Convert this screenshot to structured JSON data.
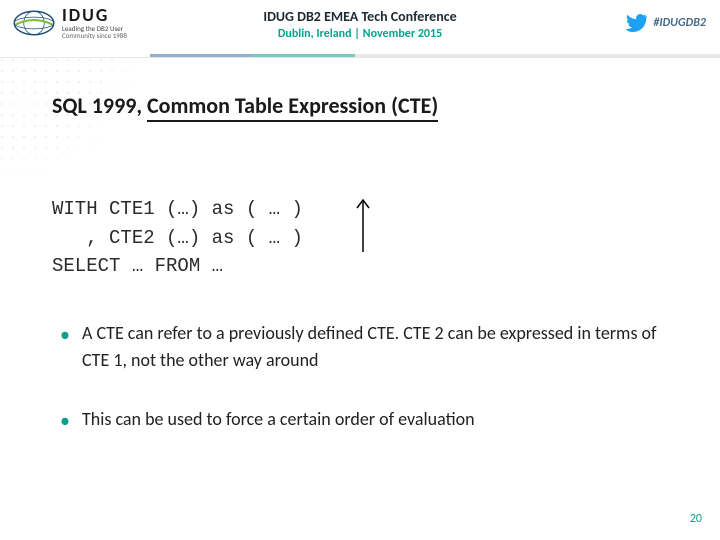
{
  "header": {
    "brand": "IDUG",
    "tagline1": "Leading the DB2 User",
    "tagline2": "Community since 1988",
    "conference_title": "IDUG DB2 EMEA Tech Conference",
    "conference_location": "Dublin, Ireland  |  November 2015",
    "hashtag": "#IDUGDB2"
  },
  "title_prefix": "SQL 1999, ",
  "title_rest": "Common Table Expression (CTE)",
  "code": {
    "l1": "WITH CTE1 (…) as ( … )",
    "l2": "   , CTE2 (…) as ( … )",
    "l3": "SELECT … FROM …"
  },
  "bullets": {
    "b1": "A CTE can refer to a previously defined CTE. CTE 2 can be expressed in terms of CTE 1, not the other way around",
    "b2": "This can be used to force a certain order of evaluation"
  },
  "page_number": "20",
  "colors": {
    "accent_teal": "#0a9f8e",
    "accent_blue": "#3a6ea5",
    "twitter": "#1da1f2"
  }
}
